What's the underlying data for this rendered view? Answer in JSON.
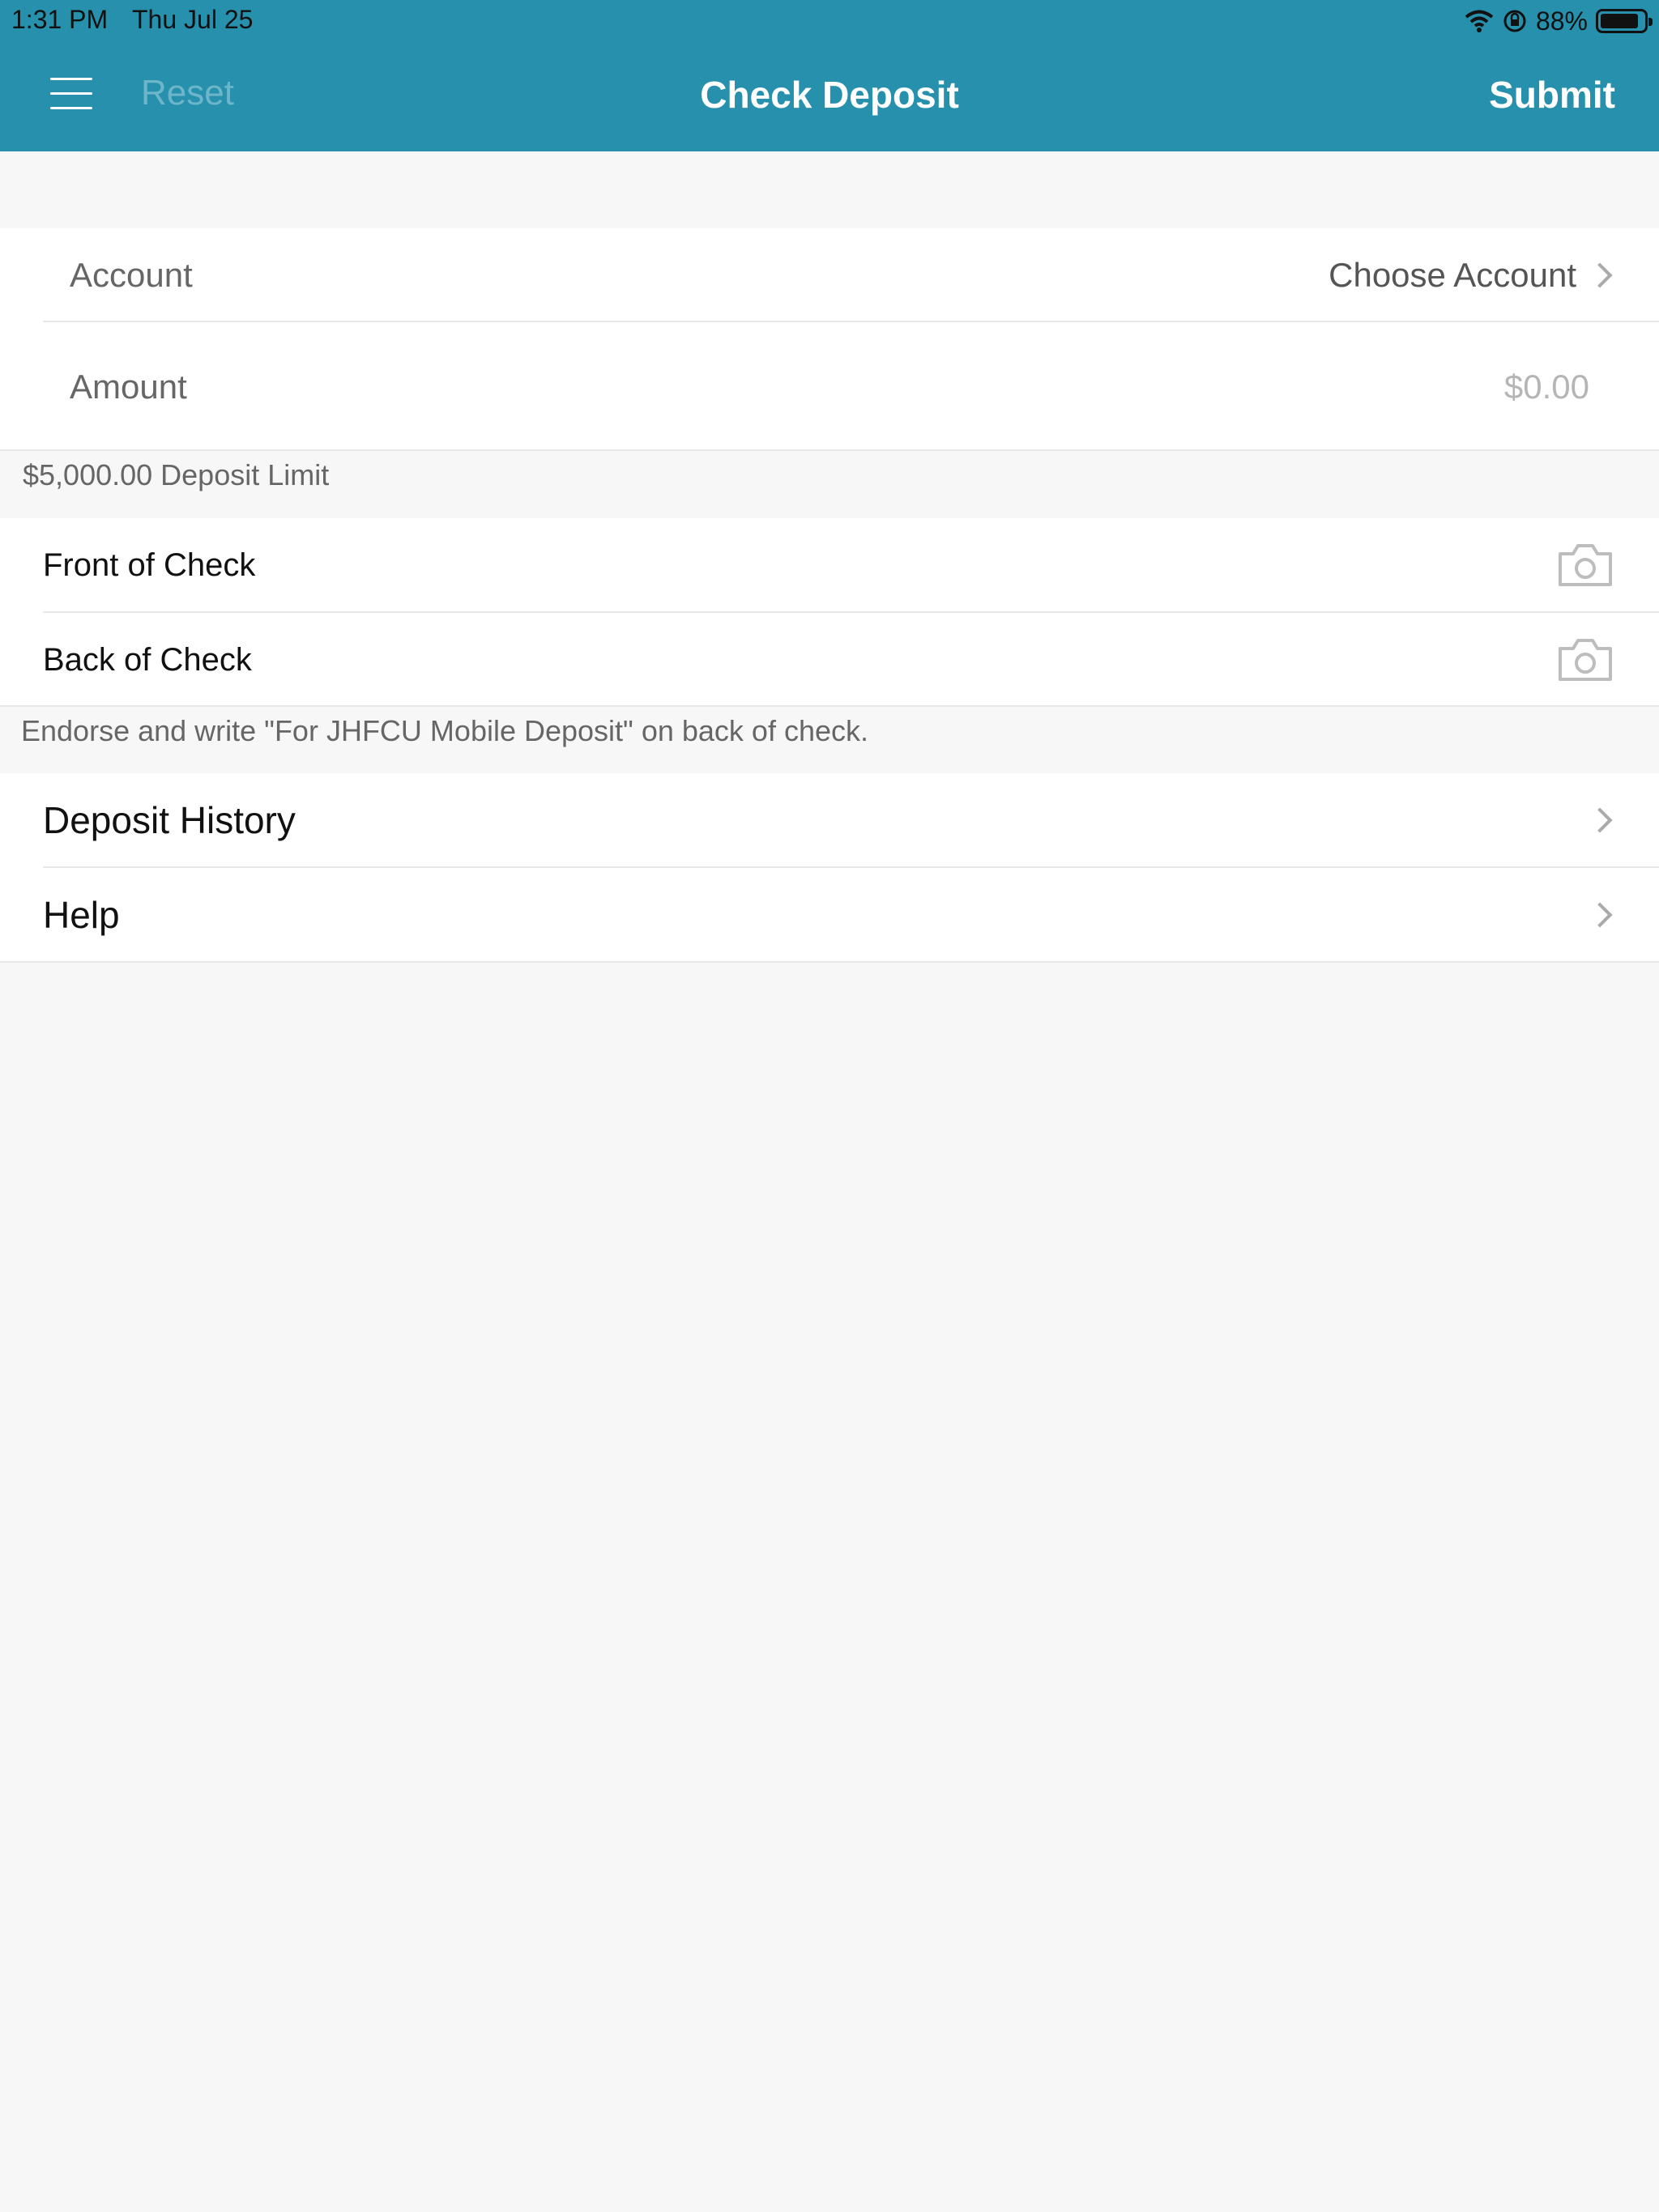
{
  "status": {
    "time": "1:31 PM",
    "date": "Thu Jul 25",
    "battery": "88%",
    "battery_level": 0.88
  },
  "nav": {
    "reset_label": "Reset",
    "title": "Check Deposit",
    "submit_label": "Submit"
  },
  "form": {
    "account_label": "Account",
    "account_value": "Choose Account",
    "amount_label": "Amount",
    "amount_placeholder": "$0.00",
    "limit_note": "$5,000.00 Deposit Limit"
  },
  "check": {
    "front_label": "Front of Check",
    "back_label": "Back of Check",
    "endorse_note": "Endorse and write \"For JHFCU Mobile Deposit\" on back of check."
  },
  "links": {
    "history_label": "Deposit History",
    "help_label": "Help"
  },
  "colors": {
    "header": "#2690ad",
    "background": "#f7f7f7"
  },
  "icons": [
    "hamburger-menu-icon",
    "wifi-icon",
    "rotation-lock-icon",
    "battery-icon",
    "camera-icon",
    "chevron-right-icon"
  ]
}
